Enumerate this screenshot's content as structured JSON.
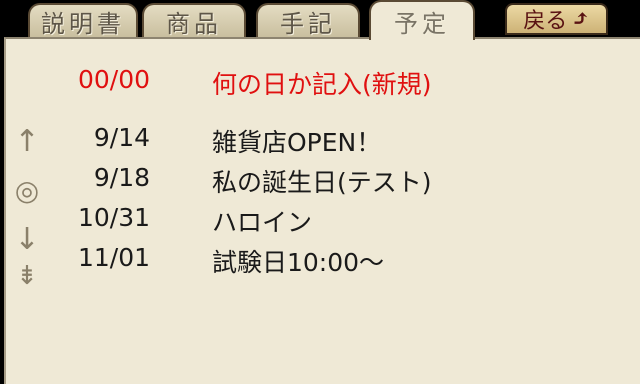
{
  "tabs": [
    {
      "label": "説明書",
      "active": false
    },
    {
      "label": "商品",
      "active": false
    },
    {
      "label": "手記",
      "active": false
    },
    {
      "label": "予定",
      "active": true
    }
  ],
  "back": {
    "label": "戻る",
    "icon": "curved-up-arrow-icon",
    "icon_glyph": "⤴"
  },
  "nav": {
    "up_glyph": "↑",
    "current_glyph": "◎",
    "down_glyph": "↓",
    "end_glyph": "⇟"
  },
  "new_entry": {
    "date": "00/00",
    "title": "何の日か記入(新規)",
    "color": "#e01010"
  },
  "events": [
    {
      "date": "9/14",
      "title": "雑貨店OPEN！"
    },
    {
      "date": "9/18",
      "title": "私の誕生日(テスト)"
    },
    {
      "date": "10/31",
      "title": "ハロイン"
    },
    {
      "date": "11/01",
      "title": "試験日10:00〜"
    }
  ],
  "colors": {
    "panel": "#efe9d6",
    "tab": "#d6cdb0",
    "back_button": "#dcc48b",
    "accent_red": "#e01010",
    "icon_gray": "#8a806a"
  }
}
